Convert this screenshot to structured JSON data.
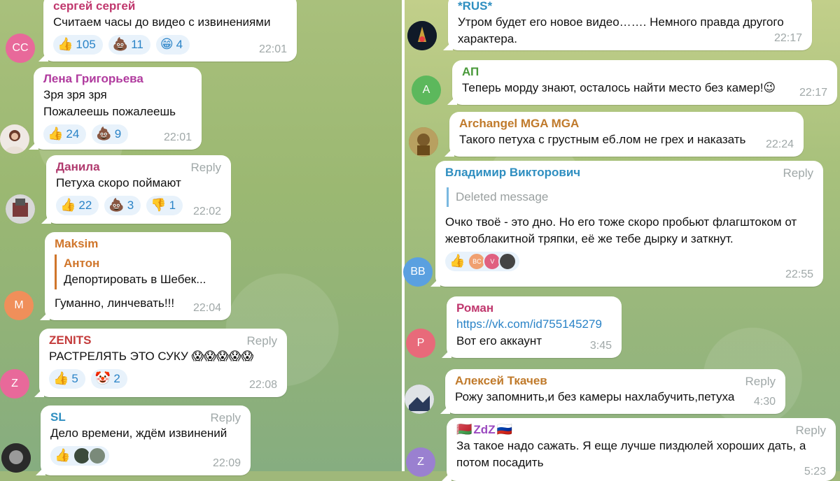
{
  "colors": {
    "name_sergey": "#c0386e",
    "name_lena": "#b03a9e",
    "name_danila": "#b03a6e",
    "name_maksim": "#d0762b",
    "name_anton": "#d0762b",
    "name_zenits": "#c43b3b",
    "name_sl": "#2e8ec0",
    "name_rus": "#2e8ec0",
    "name_ap": "#4a9a3b",
    "name_archangel": "#c07a2b",
    "name_vladimir": "#2e8ec0",
    "name_roman": "#c0386e",
    "name_aleksey": "#c07a2b",
    "name_zdz": "#9b4ac0",
    "reaction_count": "#2a83c7"
  },
  "left": {
    "messages": [
      {
        "sender": "сергей сергей",
        "avatar_initials": "СС",
        "text": "Считаем часы до видео с извинениями",
        "reactions": [
          {
            "emoji": "👍",
            "count": "105"
          },
          {
            "emoji": "💩",
            "count": "11"
          },
          {
            "emoji": "😁",
            "count": "4"
          }
        ],
        "time": "22:01"
      },
      {
        "sender": "Лена Григорьева",
        "lines": [
          "Зря зря зря",
          "Пожалеешь пожалеешь"
        ],
        "reactions": [
          {
            "emoji": "👍",
            "count": "24"
          },
          {
            "emoji": "💩",
            "count": "9"
          }
        ],
        "time": "22:01"
      },
      {
        "sender": "Данила",
        "reply_label": "Reply",
        "text": "Петуха скоро поймают",
        "reactions": [
          {
            "emoji": "👍",
            "count": "22"
          },
          {
            "emoji": "💩",
            "count": "3"
          },
          {
            "emoji": "👎",
            "count": "1"
          }
        ],
        "time": "22:02"
      },
      {
        "sender": "Maksim",
        "avatar_initials": "M",
        "quote_name": "Антон",
        "quote_text": "Депортировать в Шебек...",
        "text": "Гуманно, линчевать!!!",
        "time": "22:04"
      },
      {
        "sender": "ZENITS",
        "avatar_initials": "Z",
        "reply_label": "Reply",
        "text": "РАСТРЕЛЯТЬ  ЭТО СУКУ 😱😱😱😱😱",
        "reactions": [
          {
            "emoji": "👍",
            "count": "5"
          },
          {
            "emoji": "🤡",
            "count": "2"
          }
        ],
        "time": "22:08"
      },
      {
        "sender": "SL",
        "reply_label": "Reply",
        "text": "Дело времени, ждём извинений",
        "reactions": [
          {
            "emoji": "👍",
            "count": ""
          }
        ],
        "time": "22:09"
      }
    ]
  },
  "right": {
    "messages": [
      {
        "sender": "*RUS*",
        "lines": [
          "Утром будет его новое видео……. Немного правда другого",
          "характера."
        ],
        "time": "22:17"
      },
      {
        "sender": "АП",
        "avatar_initials": "А",
        "text": "Теперь морду знают, осталось найти место без камер!😉",
        "time": "22:17"
      },
      {
        "sender": "Archangel MGA MGA",
        "text": "Такого петуха с грустным еб.лом не грех и наказать",
        "time": "22:24"
      },
      {
        "sender": "Владимир Викторович",
        "avatar_initials": "BB",
        "reply_label": "Reply",
        "deleted": "Deleted message",
        "lines": [
          "Очко твоё - это дно. Но его тоже скоро пробьют флагштоком от",
          "жевтоблакитной тряпки, её же тебе дырку и заткнут."
        ],
        "reactions": [
          {
            "emoji": "👍",
            "count": ""
          }
        ],
        "mini_avatars": [
          "BC",
          "V",
          ""
        ],
        "time": "22:55"
      },
      {
        "sender": "Роман",
        "avatar_initials": "P",
        "link": "https://vk.com/id755145279",
        "text": "Вот его аккаунт",
        "time": "3:45"
      },
      {
        "sender": "Алексей Ткачев",
        "reply_label": "Reply",
        "text": "Рожу запомнить,и без камеры нахлабучить,петуха",
        "time": "4:30"
      },
      {
        "sender": "ZdZ",
        "sender_flags": [
          "🇧🇾",
          "🇷🇺"
        ],
        "avatar_initials": "Z",
        "reply_label": "Reply",
        "lines": [
          "За такое надо сажать. Я еще лучше пиздюлей хороших дать, а",
          "потом посадить"
        ],
        "time": "5:23"
      }
    ]
  }
}
